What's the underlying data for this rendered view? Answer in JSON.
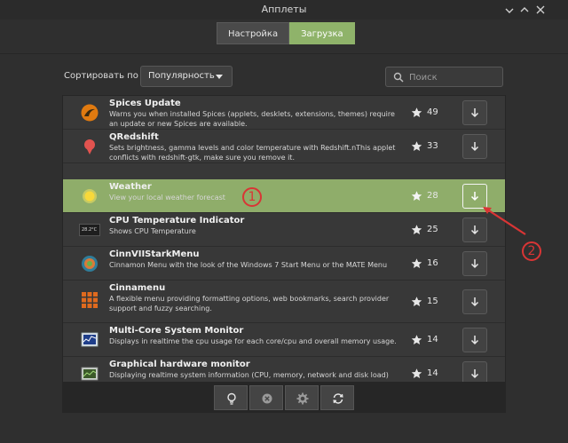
{
  "window": {
    "title": "Апплеты",
    "minimize_icon": "minimize-icon",
    "maximize_icon": "maximize-icon",
    "close_icon": "close-icon"
  },
  "tabs": [
    {
      "label": "Настройка",
      "active": false
    },
    {
      "label": "Загрузка",
      "active": true
    }
  ],
  "sort": {
    "label": "Сортировать по",
    "value": "Популярность"
  },
  "search": {
    "placeholder": "Поиск"
  },
  "applets": [
    {
      "name": "Spices Update",
      "description": "Warns you when installed Spices (applets, desklets, extensions, themes) require an update or new Spices are available.",
      "score": "49",
      "icon": "spices-update-icon",
      "selected": false
    },
    {
      "name": "QRedshift",
      "description": "Sets brightness, gamma levels and color temperature with Redshift.nThis applet conflicts with redshift-gtk, make sure you remove it.",
      "score": "33",
      "icon": "qredshift-icon",
      "selected": false
    },
    {
      "name": "Weather",
      "description": "View your local weather forecast",
      "score": "28",
      "icon": "weather-icon",
      "selected": true
    },
    {
      "name": "CPU Temperature Indicator",
      "description": "Shows CPU Temperature",
      "score": "25",
      "icon": "cpu-temperature-icon",
      "icon_text": "28.2°C",
      "selected": false
    },
    {
      "name": "CinnVIIStarkMenu",
      "description": "Cinnamon Menu with the look of the Windows 7 Start Menu or the MATE Menu",
      "score": "16",
      "icon": "cinnviistarkmenu-icon",
      "selected": false
    },
    {
      "name": "Cinnamenu",
      "description": "A flexible menu providing formatting options, web bookmarks, search provider support and fuzzy searching.",
      "score": "15",
      "icon": "cinnamenu-icon",
      "selected": false
    },
    {
      "name": "Multi-Core System Monitor",
      "description": "Displays in realtime the cpu usage for each core/cpu and overall memory usage.",
      "score": "14",
      "icon": "system-monitor-icon",
      "selected": false
    },
    {
      "name": "Graphical hardware monitor",
      "description": "Displaying realtime system information (CPU, memory, network and disk load)",
      "score": "14",
      "icon": "hardware-monitor-icon",
      "selected": false
    }
  ],
  "toolbar": [
    {
      "icon": "info-bulb-icon"
    },
    {
      "icon": "remove-icon"
    },
    {
      "icon": "settings-gear-icon"
    },
    {
      "icon": "refresh-icon"
    }
  ],
  "annotations": [
    {
      "label": "1"
    },
    {
      "label": "2"
    }
  ],
  "colors": {
    "accent": "#8fb36a",
    "selected_row": "#8fad6a",
    "annotation": "#d93535",
    "star": "#e6e6e6"
  }
}
